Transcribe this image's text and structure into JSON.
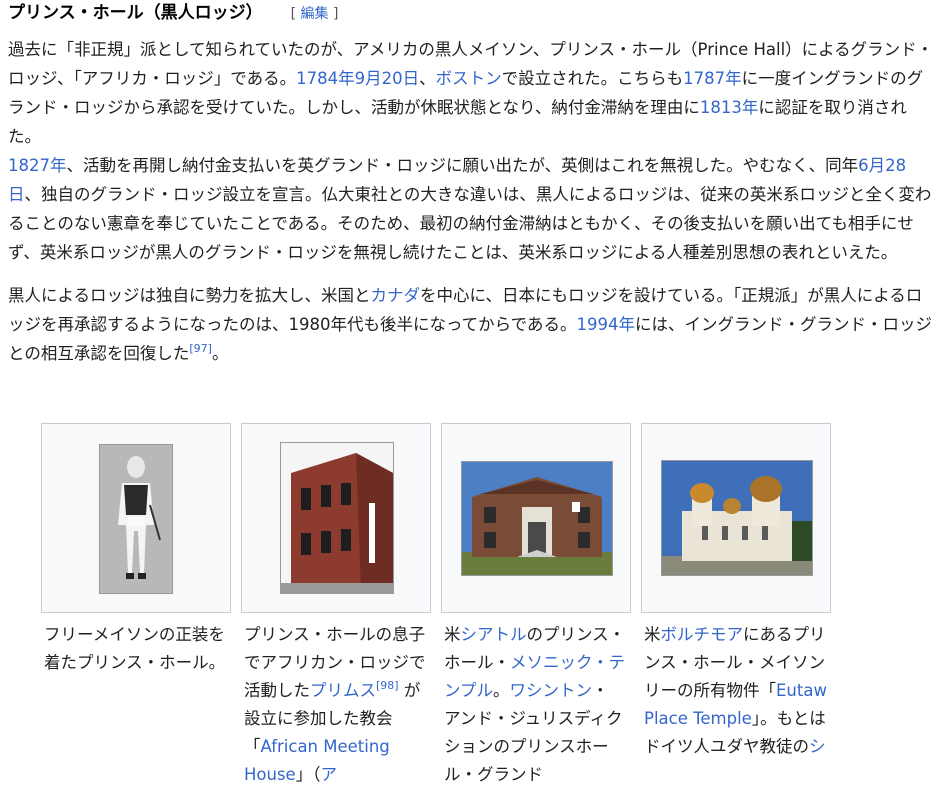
{
  "section": {
    "title": "プリンス・ホール（黒人ロッジ）",
    "edit_open": "[ ",
    "edit_label": "編集",
    "edit_close": " ]"
  },
  "para1": [
    {
      "t": "過去に「非正規」派として知られていたのが、アメリカの黒人メイソン、プリンス・ホール（Prince Hall）によるグランド・ロッジ、「アフリカ・ロッジ」である。"
    },
    {
      "t": "1784年",
      "link": true
    },
    {
      "t": "9月20日",
      "link": true
    },
    {
      "t": "、"
    },
    {
      "t": "ボストン",
      "link": true
    },
    {
      "t": "で設立された。こちらも"
    },
    {
      "t": "1787年",
      "link": true
    },
    {
      "t": "に一度イングランドのグランド・ロッジから承認を受けていた。しかし、活動が休眠状態となり、納付金滞納を理由に"
    },
    {
      "t": "1813年",
      "link": true
    },
    {
      "t": "に認証を取り消された。"
    },
    {
      "br": true
    },
    {
      "t": "1827年",
      "link": true
    },
    {
      "t": "、活動を再開し納付金支払いを英グランド・ロッジに願い出たが、英側はこれを無視した。やむなく、同年"
    },
    {
      "t": "6月28日",
      "link": true
    },
    {
      "t": "、独自のグランド・ロッジ設立を宣言。仏大東社との大きな違いは、黒人によるロッジは、従来の英米系ロッジと全く変わることのない憲章を奉じていたことである。そのため、最初の納付金滞納はともかく、その後支払いを願い出ても相手にせず、英米系ロッジが黒人のグランド・ロッジを無視し続けたことは、英米系ロッジによる人種差別思想の表れといえた。"
    }
  ],
  "para2": [
    {
      "t": "黒人によるロッジは独自に勢力を拡大し、米国と"
    },
    {
      "t": "カナダ",
      "link": true
    },
    {
      "t": "を中心に、日本にもロッジを設けている。「正規派」が黒人によるロッジを再承認するようになったのは、1980年代も後半になってからである。"
    },
    {
      "t": "1994年",
      "link": true
    },
    {
      "t": "には、イングランド・グランド・ロッジとの相互承認を回復した"
    },
    {
      "t": "[97]",
      "sup": true
    },
    {
      "t": "。"
    }
  ],
  "gallery": [
    {
      "image_icon": "portrait-image",
      "caption": [
        {
          "t": "フリーメイソンの正装を着たプリンス・ホール。"
        }
      ]
    },
    {
      "image_icon": "brick-church-image",
      "caption": [
        {
          "t": "プリンス・ホールの息子でアフリカン・ロッジで活動した"
        },
        {
          "t": "プリムス",
          "link": true
        },
        {
          "t": "[98]",
          "sup": true
        },
        {
          "t": " が設立に参加した教会「"
        },
        {
          "t": "African Meeting House",
          "link": true
        },
        {
          "t": "」（"
        },
        {
          "t": "ア",
          "link": true
        }
      ]
    },
    {
      "image_icon": "masonic-temple-image",
      "caption": [
        {
          "t": "米"
        },
        {
          "t": "シアトル",
          "link": true
        },
        {
          "t": "のプリンス・ホール・"
        },
        {
          "t": "メソニック・テンプル",
          "link": true
        },
        {
          "t": "。"
        },
        {
          "t": "ワシントン",
          "link": true
        },
        {
          "t": "・ アンド・ジュリスディクションのプリンスホール・グランド"
        }
      ]
    },
    {
      "image_icon": "domed-temple-image",
      "caption": [
        {
          "t": "米"
        },
        {
          "t": "ボルチモア",
          "link": true
        },
        {
          "t": "にあるプリンス・ホール・メイソンリーの所有物件「"
        },
        {
          "t": "Eutaw Place Temple",
          "link": true
        },
        {
          "t": "」。もとはドイツ人ユダヤ教徒の"
        },
        {
          "t": "シ",
          "link": true
        }
      ]
    }
  ],
  "colors": {
    "link": "#3366cc",
    "text": "#202122",
    "frame_border": "#c8ccd1",
    "frame_bg": "#f8f9fa"
  }
}
